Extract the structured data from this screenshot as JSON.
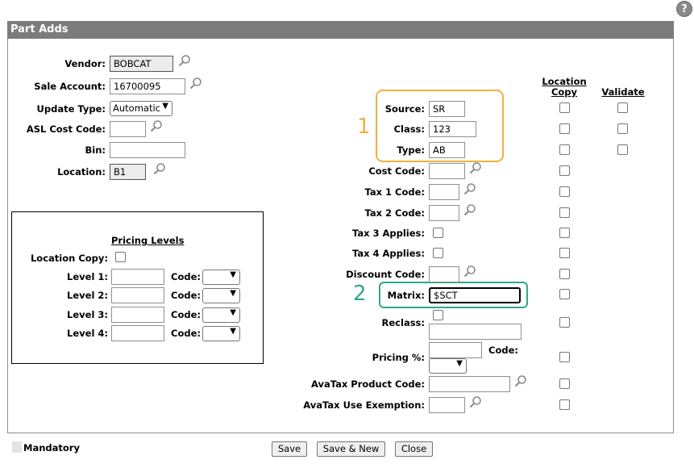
{
  "help": {
    "label": "?"
  },
  "panel": {
    "title": "Part Adds"
  },
  "left_fields": {
    "vendor": {
      "label": "Vendor:",
      "value": "BOBCAT"
    },
    "sale_account": {
      "label": "Sale Account:",
      "value": "16700095"
    },
    "update_type": {
      "label": "Update Type:",
      "value": "Automatic"
    },
    "asl_cost_code": {
      "label": "ASL Cost Code:",
      "value": ""
    },
    "bin": {
      "label": "Bin:",
      "value": ""
    },
    "location": {
      "label": "Location:",
      "value": "B1"
    }
  },
  "pricing_levels": {
    "title": "Pricing Levels",
    "location_copy_label": "Location Copy:",
    "code_label": "Code:",
    "levels": [
      {
        "label": "Level 1:",
        "value": ""
      },
      {
        "label": "Level 2:",
        "value": ""
      },
      {
        "label": "Level 3:",
        "value": ""
      },
      {
        "label": "Level 4:",
        "value": ""
      }
    ]
  },
  "right_fields": {
    "source": {
      "label": "Source:",
      "value": "SR"
    },
    "class": {
      "label": "Class:",
      "value": "123"
    },
    "type": {
      "label": "Type:",
      "value": "AB"
    },
    "cost_code": {
      "label": "Cost Code:",
      "value": ""
    },
    "tax1_code": {
      "label": "Tax 1 Code:",
      "value": ""
    },
    "tax2_code": {
      "label": "Tax 2 Code:",
      "value": ""
    },
    "tax3_applies": {
      "label": "Tax 3 Applies:"
    },
    "tax4_applies": {
      "label": "Tax 4 Applies:"
    },
    "discount_code": {
      "label": "Discount Code:",
      "value": ""
    },
    "matrix": {
      "label": "Matrix:",
      "value": "$SCT"
    },
    "reclass": {
      "label": "Reclass:",
      "value": ""
    },
    "pricing_pct": {
      "label": "Pricing %:",
      "value": "",
      "code_label": "Code:"
    },
    "avatax_product_code": {
      "label": "AvaTax Product Code:",
      "value": ""
    },
    "avatax_use_exemption": {
      "label": "AvaTax Use Exemption:",
      "value": ""
    }
  },
  "columns": {
    "location_copy_line1": "Location",
    "location_copy_line2": "Copy",
    "validate": "Validate"
  },
  "callouts": {
    "one": "1",
    "two": "2"
  },
  "colors": {
    "callout_orange": "#f0b040",
    "callout_green": "#2fa88a",
    "title_bar": "#7c7c7c"
  },
  "footer": {
    "mandatory": "Mandatory",
    "save": "Save",
    "save_new": "Save & New",
    "close": "Close"
  }
}
